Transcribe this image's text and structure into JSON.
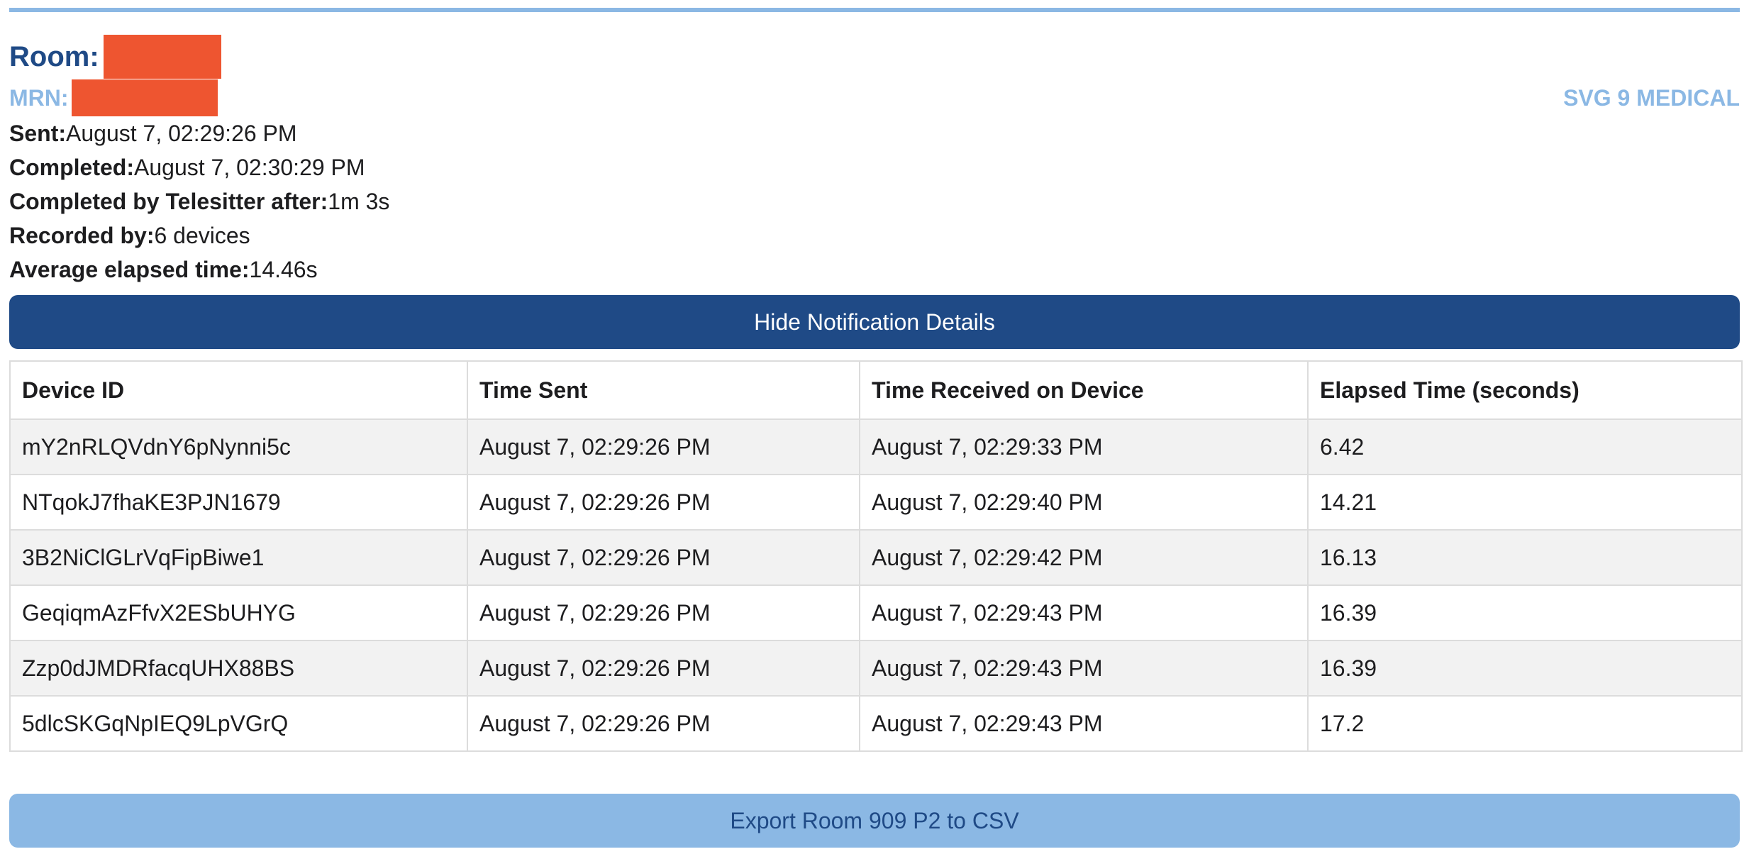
{
  "header": {
    "room_label": "Room:",
    "mrn_label": "MRN:",
    "brand": "SVG 9 MEDICAL",
    "redaction_color": "#ee5530"
  },
  "info": {
    "sent_label": "Sent:",
    "sent_value": "August 7, 02:29:26 PM",
    "completed_label": "Completed:",
    "completed_value": "August 7, 02:30:29 PM",
    "telesitter_label": "Completed by Telesitter after:",
    "telesitter_value": "1m 3s",
    "recorded_label": "Recorded by:",
    "recorded_value": "6 devices",
    "avg_label": "Average elapsed time:",
    "avg_value": "14.46s"
  },
  "hide_button": {
    "label": "Hide Notification Details",
    "color": "#1f4a86"
  },
  "table": {
    "columns": [
      "Device ID",
      "Time Sent",
      "Time Received on Device",
      "Elapsed Time (seconds)"
    ],
    "rows": [
      [
        "mY2nRLQVdnY6pNynni5c",
        "August 7, 02:29:26 PM",
        "August 7, 02:29:33 PM",
        "6.42"
      ],
      [
        "NTqokJ7fhaKE3PJN1679",
        "August 7, 02:29:26 PM",
        "August 7, 02:29:40 PM",
        "14.21"
      ],
      [
        "3B2NiClGLrVqFipBiwe1",
        "August 7, 02:29:26 PM",
        "August 7, 02:29:42 PM",
        "16.13"
      ],
      [
        "GeqiqmAzFfvX2ESbUHYG",
        "August 7, 02:29:26 PM",
        "August 7, 02:29:43 PM",
        "16.39"
      ],
      [
        "Zzp0dJMDRfacqUHX88BS",
        "August 7, 02:29:26 PM",
        "August 7, 02:29:43 PM",
        "16.39"
      ],
      [
        "5dlcSKGqNpIEQ9LpVGrQ",
        "August 7, 02:29:26 PM",
        "August 7, 02:29:43 PM",
        "17.2"
      ]
    ]
  },
  "export_button": {
    "label": "Export Room 909 P2 to CSV",
    "color": "#8bb8e4"
  }
}
